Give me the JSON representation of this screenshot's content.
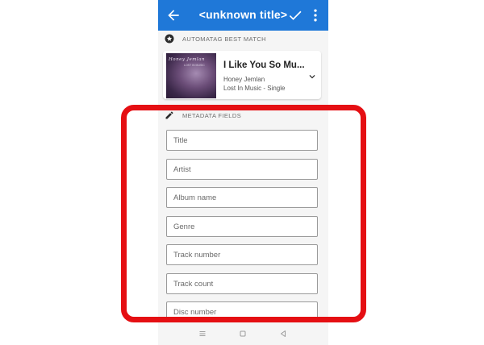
{
  "appbar": {
    "title": "<unknown title>",
    "back_icon": "arrow-left-icon",
    "confirm_icon": "check-icon",
    "more_icon": "more-vert-icon",
    "color": "#1f78d8"
  },
  "automatag": {
    "section_label": "AUTOMATAG BEST MATCH",
    "icon": "star-circle-icon",
    "cover_artist": "Honey Jemlan",
    "cover_subtitle": "LOST IN MUSIC",
    "song_title": "I Like You So Mu...",
    "artist": "Honey Jemlan",
    "album": "Lost In Music - Single",
    "expand_icon": "chevron-down-icon"
  },
  "metadata": {
    "section_label": "METADATA FIELDS",
    "icon": "pencil-icon",
    "fields": [
      {
        "placeholder": "Title"
      },
      {
        "placeholder": "Artist"
      },
      {
        "placeholder": "Album name"
      },
      {
        "placeholder": "Genre"
      },
      {
        "placeholder": "Track number"
      },
      {
        "placeholder": "Track count"
      },
      {
        "placeholder": "Disc number"
      }
    ]
  },
  "navbar": {
    "menu_icon": "menu-icon",
    "home_icon": "home-square-icon",
    "back_icon": "back-triangle-icon"
  },
  "highlight_color": "#e50f13"
}
